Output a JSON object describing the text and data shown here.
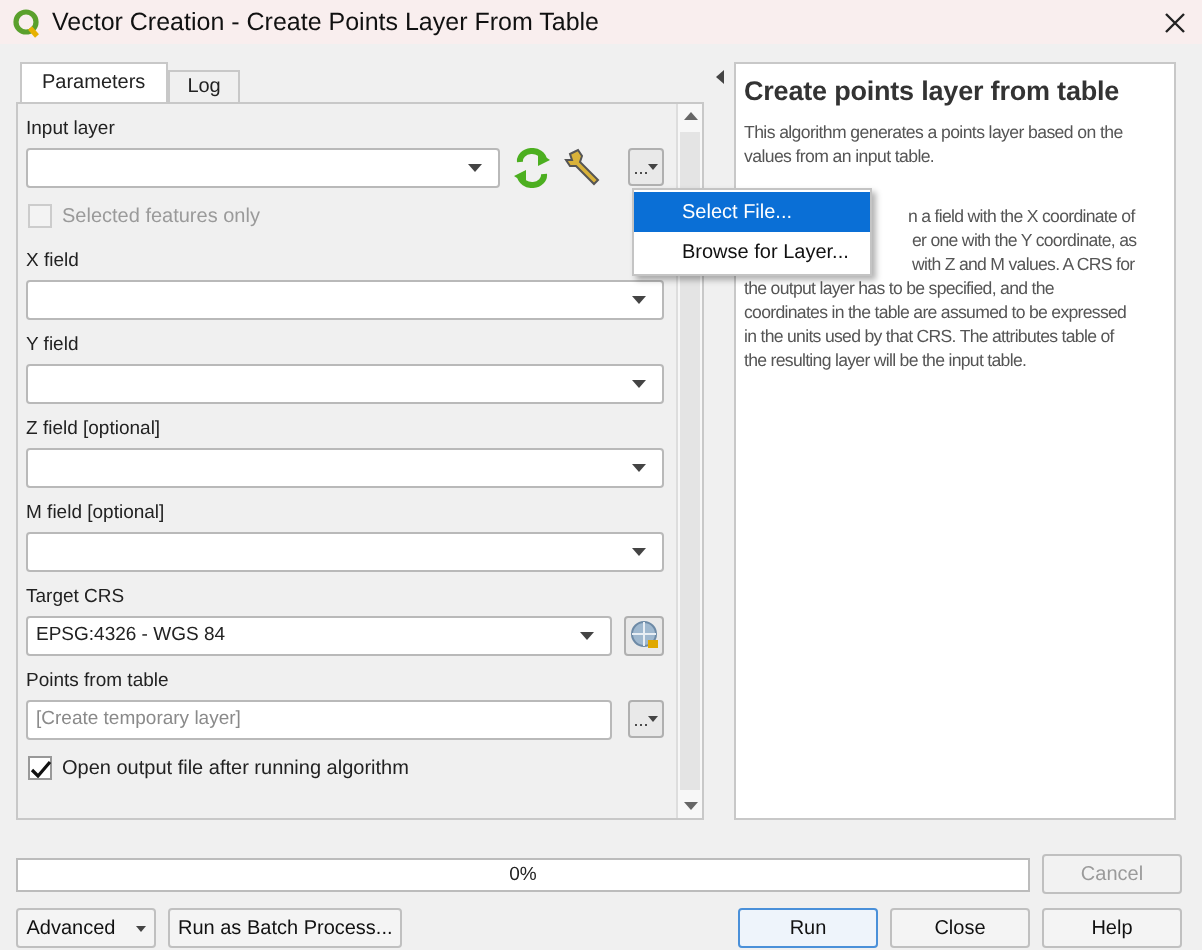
{
  "window": {
    "title": "Vector Creation - Create Points Layer From Table"
  },
  "tabs": [
    {
      "label": "Parameters",
      "selected": true
    },
    {
      "label": "Log",
      "selected": false
    }
  ],
  "parameters": [
    {
      "kind": "layer",
      "label": "Input layer",
      "button_label": "..."
    },
    {
      "kind": "checkbox",
      "label": "Selected features only",
      "checked": false,
      "disabled": true
    },
    {
      "kind": "combo",
      "label": "X field"
    },
    {
      "kind": "combo",
      "label": "Y field"
    },
    {
      "kind": "combo",
      "label": "Z field [optional]"
    },
    {
      "kind": "combo",
      "label": "M field [optional]"
    },
    {
      "kind": "crs",
      "label": "Target CRS",
      "value": "EPSG:4326 - WGS 84"
    },
    {
      "kind": "output",
      "label": "Points from table",
      "placeholder": "[Create temporary layer]",
      "button_label": "..."
    },
    {
      "kind": "checkbox",
      "label": "Open output file after running algorithm",
      "checked": true,
      "disabled": false
    }
  ],
  "menu": {
    "items": [
      {
        "label": "Select File...",
        "selected": true
      },
      {
        "label": "Browse for Layer...",
        "selected": false
      }
    ]
  },
  "help": {
    "title": "Create points layer from table",
    "paragraph": "This algorithm generates a points layer based on the values from an input table.",
    "visible_lines": [
      "n a field with the X coordinate of",
      "er one with the Y coordinate, as",
      "with Z and M values. A CRS for",
      "the output layer has to be specified, and the",
      "coordinates in the table are assumed to be expressed",
      "in the units used by that CRS. The attributes table of",
      "the resulting layer will be the input table."
    ]
  },
  "progress": {
    "level": 0,
    "text": "0%"
  },
  "cancel": {
    "label": "Cancel",
    "disabled": true
  },
  "left_buttons": [
    {
      "kind": "menu",
      "label": "Advanced"
    },
    {
      "kind": "push",
      "label": "Run as Batch Process..."
    }
  ],
  "right_buttons": [
    {
      "label": "Run",
      "default": true
    },
    {
      "label": "Close",
      "default": false
    },
    {
      "label": "Help",
      "default": false
    }
  ]
}
